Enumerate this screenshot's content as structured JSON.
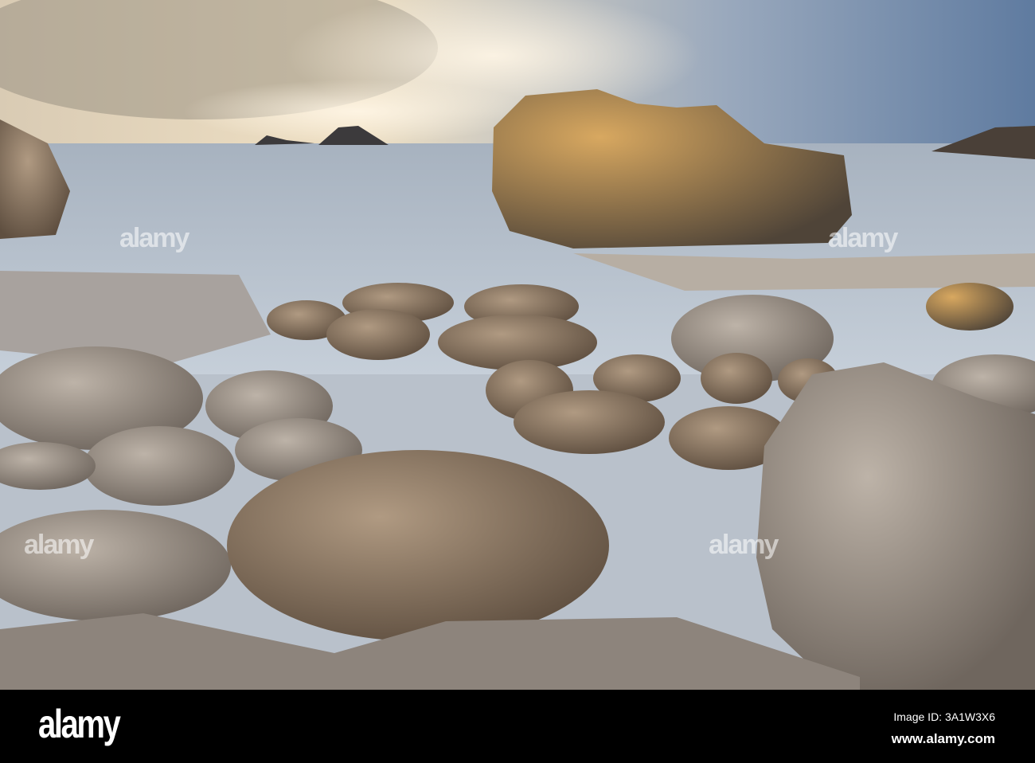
{
  "photo": {
    "subject": "boulders on beach with sea stack at sunset",
    "colors": {
      "sky_top": "#6f87a6",
      "sky_glow": "#f3e2c3",
      "sea": "#a9b6c6",
      "rock": "#8a7560",
      "rock_lit": "#d2a25a"
    }
  },
  "watermark": {
    "text": "alamy"
  },
  "footer": {
    "logo": "alamy",
    "image_id": "Image ID: 3A1W3X6",
    "site": "www.alamy.com"
  }
}
